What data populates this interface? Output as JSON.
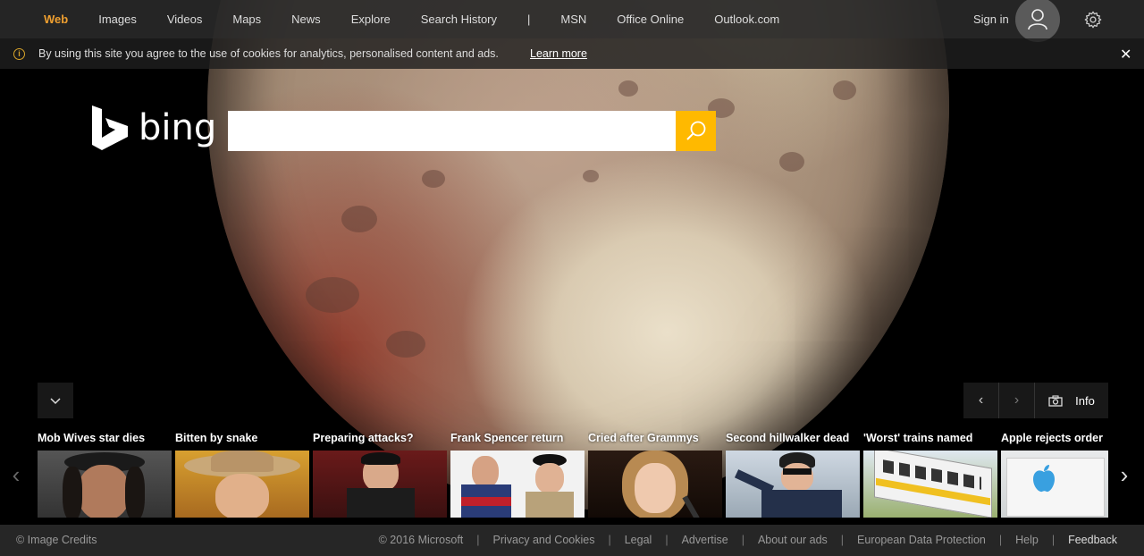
{
  "nav": {
    "items": [
      "Web",
      "Images",
      "Videos",
      "Maps",
      "News",
      "Explore",
      "Search History"
    ],
    "separator": "|",
    "right_items": [
      "MSN",
      "Office Online",
      "Outlook.com"
    ],
    "sign_in": "Sign in"
  },
  "cookie": {
    "text": "By using this site you agree to the use of cookies for analytics, personalised content and ads.",
    "link": "Learn more",
    "close": "✕",
    "info_glyph": "i"
  },
  "logo": {
    "text": "bing"
  },
  "search": {
    "value": "",
    "placeholder": ""
  },
  "controls": {
    "info_label": "Info",
    "prev": "‹",
    "next": "›"
  },
  "news": [
    {
      "title": "Mob Wives star dies",
      "thumb": "woman-in-hat"
    },
    {
      "title": "Bitten by snake",
      "thumb": "man-in-cowboy-hat"
    },
    {
      "title": "Preparing attacks?",
      "thumb": "leader-at-podium"
    },
    {
      "title": "Frank Spencer return",
      "thumb": "cyclist-and-man-in-beret"
    },
    {
      "title": "Cried after Grammys",
      "thumb": "singer-at-microphone"
    },
    {
      "title": "Second hillwalker dead",
      "thumb": "hillwalker-in-beanie"
    },
    {
      "title": "'Worst' trains named",
      "thumb": "passenger-train"
    },
    {
      "title": "Apple rejects order",
      "thumb": "apple-campus-sign"
    }
  ],
  "footer": {
    "credits": "© Image Credits",
    "links": [
      "© 2016 Microsoft",
      "Privacy and Cookies",
      "Legal",
      "Advertise",
      "About our ads",
      "European Data Protection",
      "Help",
      "Feedback"
    ]
  },
  "colors": {
    "accent": "#f0a030",
    "search_button": "#ffb900",
    "topbar": "#282828"
  }
}
